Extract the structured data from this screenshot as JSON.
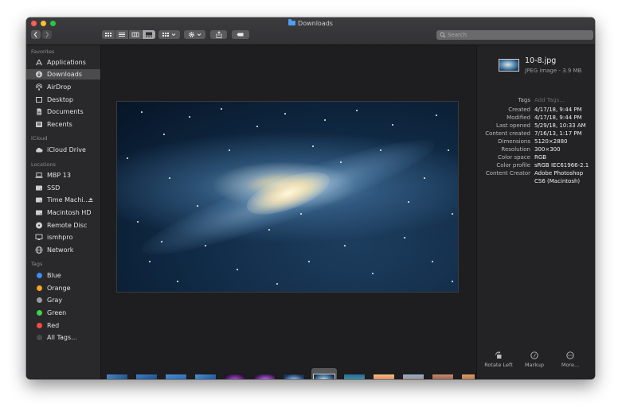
{
  "window": {
    "title": "Downloads"
  },
  "toolbar": {
    "search_placeholder": "Search"
  },
  "sidebar": {
    "favorites_header": "Favorites",
    "favorites": [
      {
        "label": "Applications",
        "icon": "applications-icon"
      },
      {
        "label": "Downloads",
        "icon": "downloads-icon",
        "selected": true
      },
      {
        "label": "AirDrop",
        "icon": "airdrop-icon"
      },
      {
        "label": "Desktop",
        "icon": "desktop-icon"
      },
      {
        "label": "Documents",
        "icon": "documents-icon"
      },
      {
        "label": "Recents",
        "icon": "recents-icon"
      }
    ],
    "icloud_header": "iCloud",
    "icloud": [
      {
        "label": "iCloud Drive",
        "icon": "cloud-icon"
      }
    ],
    "locations_header": "Locations",
    "locations": [
      {
        "label": "MBP 13",
        "icon": "laptop-icon"
      },
      {
        "label": "SSD",
        "icon": "drive-icon"
      },
      {
        "label": "Time Machi...",
        "icon": "drive-icon",
        "eject": true
      },
      {
        "label": "Macintosh HD",
        "icon": "drive-icon"
      },
      {
        "label": "Remote Disc",
        "icon": "disc-icon"
      },
      {
        "label": "ismhpro",
        "icon": "monitor-icon"
      },
      {
        "label": "Network",
        "icon": "network-icon"
      }
    ],
    "tags_header": "Tags",
    "tags": [
      {
        "label": "Blue",
        "color": "#3a8ef6"
      },
      {
        "label": "Orange",
        "color": "#f5a623"
      },
      {
        "label": "Gray",
        "color": "#9b9b9b"
      },
      {
        "label": "Green",
        "color": "#3ed34a"
      },
      {
        "label": "Red",
        "color": "#f24b43"
      },
      {
        "label": "All Tags...",
        "color": "#4a4a4c"
      }
    ]
  },
  "inspector": {
    "file_name": "10-8.jpg",
    "file_kind": "JPEG image - 3.9 MB",
    "rows": [
      {
        "label": "Tags",
        "value": "Add Tags...",
        "dim": true
      },
      {
        "label": "Created",
        "value": "4/17/18, 9:44 PM"
      },
      {
        "label": "Modified",
        "value": "4/17/18, 9:44 PM"
      },
      {
        "label": "Last opened",
        "value": "5/29/18, 10:33 AM"
      },
      {
        "label": "Content created",
        "value": "7/16/13, 1:17 PM"
      },
      {
        "label": "Dimensions",
        "value": "5120×2880"
      },
      {
        "label": "Resolution",
        "value": "300×300"
      },
      {
        "label": "Color space",
        "value": "RGB"
      },
      {
        "label": "Color profile",
        "value": "sRGB IEC61966-2.1"
      },
      {
        "label": "Content Creator",
        "value": "Adobe Photoshop",
        "value2": "CS6 (Macintosh)"
      }
    ],
    "actions": [
      {
        "label": "Rotate Left",
        "icon": "rotate-left-icon"
      },
      {
        "label": "Markup",
        "icon": "markup-icon"
      },
      {
        "label": "More...",
        "icon": "more-icon"
      }
    ]
  }
}
